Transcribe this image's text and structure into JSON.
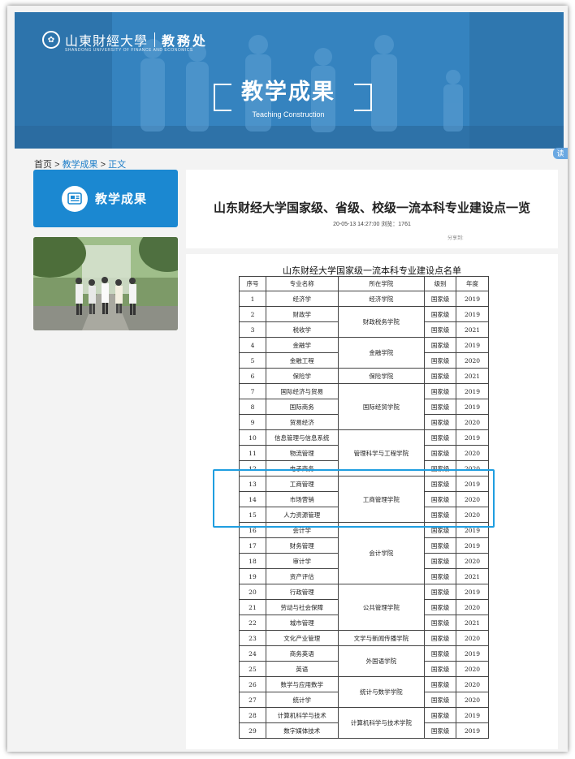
{
  "header": {
    "school_name": "山東財經大學",
    "school_sub": "SHANDONG UNIVERSITY OF FINANCE AND ECONOMICS",
    "dept_name": "教務处",
    "banner_title": "教学成果",
    "banner_subtitle": "Teaching Construction",
    "side_badge": "读"
  },
  "breadcrumb": {
    "home": "首页",
    "sep1": ">",
    "section": "教学成果",
    "sep2": ">",
    "current": "正文"
  },
  "sidebar": {
    "title": "教学成果"
  },
  "article": {
    "title": "山东财经大学国家级、省级、校级一流本科专业建设点一览",
    "meta": "20-05-13 14:27:00 浏览：1761",
    "share": "分享到:"
  },
  "table": {
    "caption": "山东财经大学国家级一流本科专业建设点名单",
    "headers": [
      "序号",
      "专业名称",
      "所在学院",
      "级别",
      "年度"
    ],
    "rows": [
      {
        "no": "1",
        "major": "经济学",
        "level": "国家级",
        "year": "2019"
      },
      {
        "no": "2",
        "major": "财政学",
        "level": "国家级",
        "year": "2019"
      },
      {
        "no": "3",
        "major": "税收学",
        "level": "国家级",
        "year": "2021"
      },
      {
        "no": "4",
        "major": "金融学",
        "level": "国家级",
        "year": "2019"
      },
      {
        "no": "5",
        "major": "金融工程",
        "level": "国家级",
        "year": "2020"
      },
      {
        "no": "6",
        "major": "保险学",
        "level": "国家级",
        "year": "2021"
      },
      {
        "no": "7",
        "major": "国际经济与贸易",
        "level": "国家级",
        "year": "2019"
      },
      {
        "no": "8",
        "major": "国际商务",
        "level": "国家级",
        "year": "2019"
      },
      {
        "no": "9",
        "major": "贸易经济",
        "level": "国家级",
        "year": "2020"
      },
      {
        "no": "10",
        "major": "信息管理与信息系统",
        "level": "国家级",
        "year": "2019"
      },
      {
        "no": "11",
        "major": "物流管理",
        "level": "国家级",
        "year": "2020"
      },
      {
        "no": "12",
        "major": "电子商务",
        "level": "国家级",
        "year": "2020"
      },
      {
        "no": "13",
        "major": "工商管理",
        "level": "国家级",
        "year": "2019"
      },
      {
        "no": "14",
        "major": "市场营销",
        "level": "国家级",
        "year": "2020"
      },
      {
        "no": "15",
        "major": "人力资源管理",
        "level": "国家级",
        "year": "2020"
      },
      {
        "no": "16",
        "major": "会计学",
        "level": "国家级",
        "year": "2019"
      },
      {
        "no": "17",
        "major": "财务管理",
        "level": "国家级",
        "year": "2019"
      },
      {
        "no": "18",
        "major": "审计学",
        "level": "国家级",
        "year": "2020"
      },
      {
        "no": "19",
        "major": "资产评估",
        "level": "国家级",
        "year": "2021"
      },
      {
        "no": "20",
        "major": "行政管理",
        "level": "国家级",
        "year": "2019"
      },
      {
        "no": "21",
        "major": "劳动与社会保障",
        "level": "国家级",
        "year": "2020"
      },
      {
        "no": "22",
        "major": "城市管理",
        "level": "国家级",
        "year": "2021"
      },
      {
        "no": "23",
        "major": "文化产业管理",
        "level": "国家级",
        "year": "2020"
      },
      {
        "no": "24",
        "major": "商务英语",
        "level": "国家级",
        "year": "2019"
      },
      {
        "no": "25",
        "major": "英语",
        "level": "国家级",
        "year": "2020"
      },
      {
        "no": "26",
        "major": "数学与应用数学",
        "level": "国家级",
        "year": "2020"
      },
      {
        "no": "27",
        "major": "统计学",
        "level": "国家级",
        "year": "2020"
      },
      {
        "no": "28",
        "major": "计算机科学与技术",
        "level": "国家级",
        "year": "2019"
      },
      {
        "no": "29",
        "major": "数字媒体技术",
        "level": "国家级",
        "year": "2019"
      }
    ],
    "colleges": [
      {
        "name": "经济学院",
        "rowspan": 1
      },
      {
        "name": "财政税务学院",
        "rowspan": 2
      },
      {
        "name": "金融学院",
        "rowspan": 2
      },
      {
        "name": "保险学院",
        "rowspan": 1
      },
      {
        "name": "国际经贸学院",
        "rowspan": 3
      },
      {
        "name": "管理科学与工程学院",
        "rowspan": 3
      },
      {
        "name": "工商管理学院",
        "rowspan": 3
      },
      {
        "name": "会计学院",
        "rowspan": 4
      },
      {
        "name": "公共管理学院",
        "rowspan": 3
      },
      {
        "name": "文学与新闻传播学院",
        "rowspan": 1
      },
      {
        "name": "外国语学院",
        "rowspan": 2
      },
      {
        "name": "统计与数学学院",
        "rowspan": 2
      },
      {
        "name": "计算机科学与技术学院",
        "rowspan": 2
      }
    ]
  }
}
